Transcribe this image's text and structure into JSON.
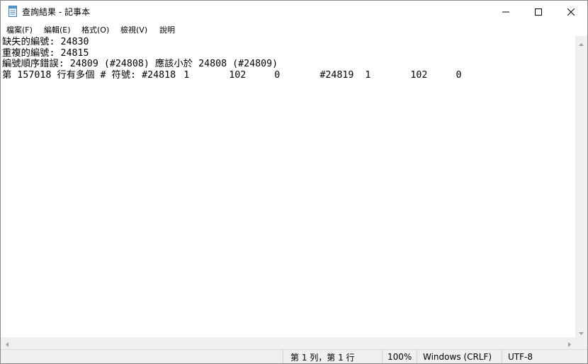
{
  "window": {
    "title": "查詢結果 - 記事本",
    "icon": "notepad-icon"
  },
  "titlebar": {
    "minimize_icon": "minimize-icon",
    "maximize_icon": "maximize-icon",
    "close_icon": "close-icon"
  },
  "menu": {
    "items": [
      {
        "label": "檔案(F)"
      },
      {
        "label": "編輯(E)"
      },
      {
        "label": "格式(O)"
      },
      {
        "label": "檢視(V)"
      },
      {
        "label": "說明"
      }
    ]
  },
  "document": {
    "lines": [
      "缺失的編號: 24830",
      "重複的編號: 24815",
      "編號順序錯誤: 24809 (#24808) 應該小於 24808 (#24809)",
      "第 157018 行有多個 # 符號: #24818\t1\t102\t0\t#24819\t1\t102\t0"
    ]
  },
  "statusbar": {
    "position": "第 1 列，第 1 行",
    "zoom": "100%",
    "line_ending": "Windows (CRLF)",
    "encoding": "UTF-8"
  }
}
